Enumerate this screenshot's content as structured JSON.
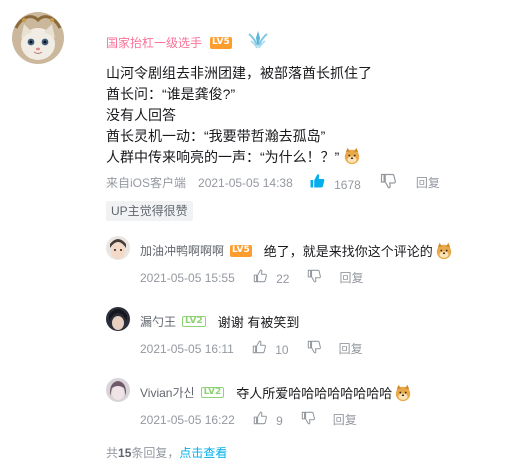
{
  "comment": {
    "username": "国家抬杠一级选手",
    "level": "LV5",
    "content_lines": [
      "山河令剧组去非洲团建，被部落酋长抓住了",
      "酋长问：“谁是龚俊?”",
      "没有人回答",
      "酋长灵机一动：“我要带哲瀚去孤岛”",
      "人群中传来响亮的一声：“为什么！？”"
    ],
    "source": "来自iOS客户端",
    "time": "2021-05-05 14:38",
    "like_count": "1678",
    "reply_label": "回复",
    "up_tag": "UP主觉得很赞"
  },
  "replies": [
    {
      "username": "加油冲鸭啊啊啊",
      "level": "LV5",
      "text": "绝了，就是来找你这个评论的",
      "time": "2021-05-05 15:55",
      "like_count": "22",
      "reply_label": "回复"
    },
    {
      "username": "漏勺王",
      "level": "LV2",
      "text": "谢谢 有被笑到",
      "time": "2021-05-05 16:11",
      "like_count": "10",
      "reply_label": "回复"
    },
    {
      "username": "Vivian가신",
      "level": "LV2",
      "text": "夺人所爱哈哈哈哈哈哈哈哈",
      "time": "2021-05-05 16:22",
      "like_count": "9",
      "reply_label": "回复"
    }
  ],
  "footer": {
    "prefix": "共",
    "count": "15",
    "suffix": "条回复，",
    "link": "点击查看"
  },
  "colors": {
    "username_pink": "#fb7299",
    "meta_gray": "#9499a0",
    "like_active_blue": "#00aeec",
    "lv5_orange": "#ff9d2c",
    "lv2_green": "#8fd275",
    "link_blue": "#00aeec"
  },
  "icons": [
    "like-icon",
    "dislike-icon",
    "medal-icon",
    "doge-emoji-icon"
  ]
}
